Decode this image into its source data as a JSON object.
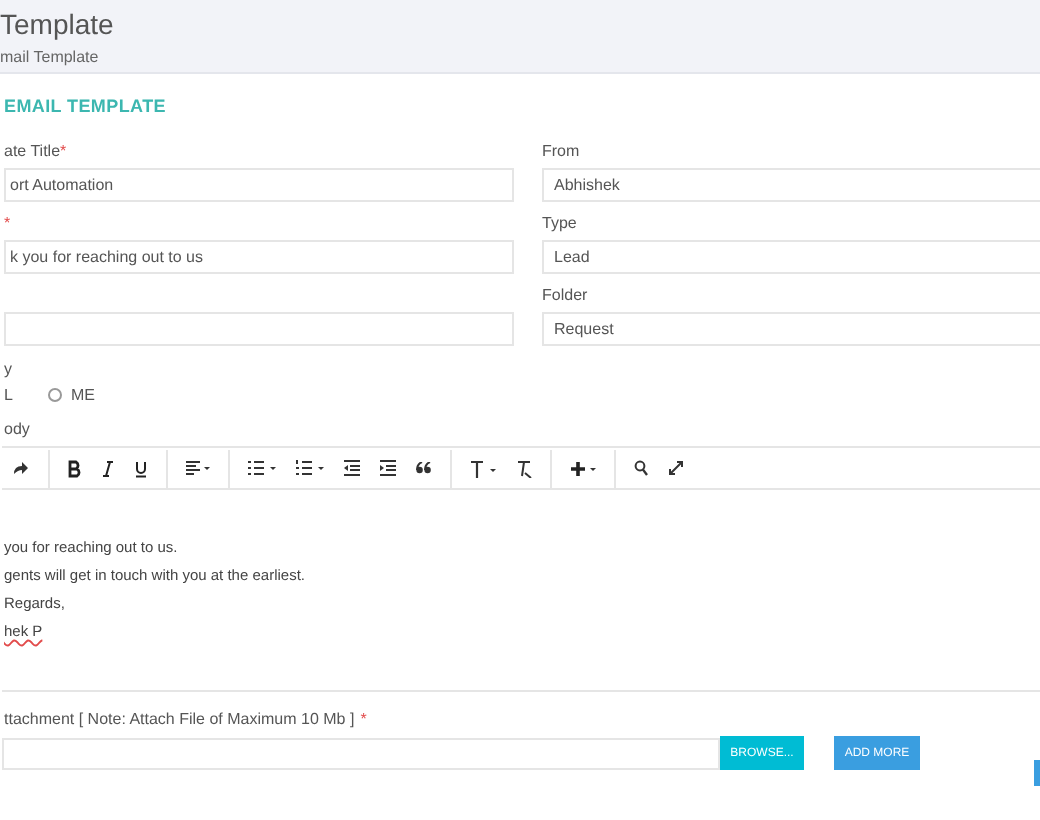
{
  "header": {
    "title": "Template",
    "breadcrumb": "mail Template"
  },
  "section_title": "EMAIL TEMPLATE",
  "left_fields": [
    {
      "kind": "input",
      "label": "ate Title",
      "mark": "*",
      "value": "ort Automation"
    },
    {
      "kind": "input",
      "mark": "*",
      "value": "k you for reaching out to us"
    },
    {
      "kind": "input"
    }
  ],
  "right_fields": [
    {
      "kind": "input",
      "label": "From",
      "value": "Abhishek"
    },
    {
      "kind": "input",
      "label": "Type",
      "value": "Lead"
    },
    {
      "kind": "input",
      "label": "Folder",
      "value": "Request"
    }
  ],
  "visibility": {
    "label": "y",
    "options": [
      {
        "label": "L"
      },
      {
        "label": "ME",
        "selected": false
      }
    ]
  },
  "body": {
    "label": "ody",
    "paragraphs": [
      "you for reaching out to us.",
      "gents will get in touch with you at the earliest.",
      "Regards,",
      "hek P"
    ]
  },
  "attachment": {
    "label": "ttachment [ Note: Attach File of Maximum 10 Mb ]",
    "mark": "*",
    "browse": "BROWSE...",
    "add_more": "ADD MORE"
  }
}
